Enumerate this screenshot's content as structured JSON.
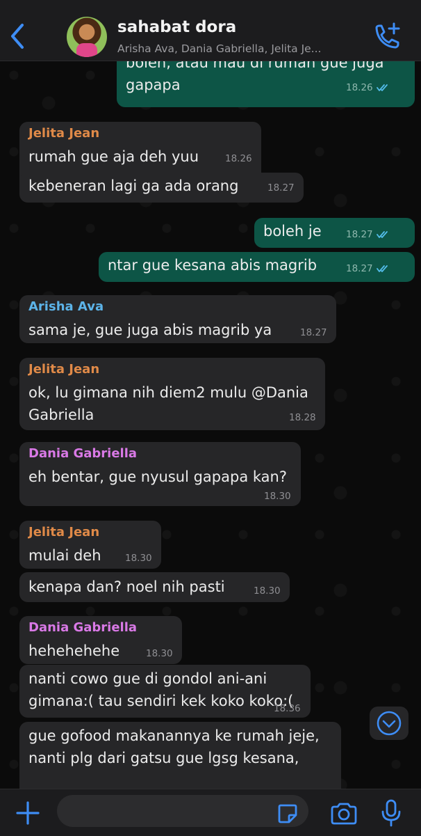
{
  "header": {
    "title": "sahabat dora",
    "subtitle": "Arisha Ava, Dania Gabriella, Jelita Je..."
  },
  "colors": {
    "accent": "#3e8df5",
    "incoming_bubble": "#262628",
    "outgoing_bubble": "#0d5546",
    "name_jelita": "#e08a48",
    "name_arisha": "#5cb3e8",
    "name_dania": "#d979e6"
  },
  "icons": {
    "back": "chevron-left-icon",
    "call": "phone-plus-icon",
    "scroll_down": "chevron-down-circle-icon",
    "attach": "plus-icon",
    "sticker": "sticker-icon",
    "camera": "camera-icon",
    "mic": "microphone-icon"
  },
  "messages": [
    {
      "dir": "out",
      "text": "boleh, atau mau di rumah gue juga\ngapapa",
      "time": "18.26",
      "read": true
    },
    {
      "dir": "in",
      "sender": "Jelita Jean",
      "text": "rumah gue aja deh yuu",
      "time": "18.26"
    },
    {
      "dir": "in",
      "text": "kebeneran lagi ga ada orang",
      "time": "18.27"
    },
    {
      "dir": "out",
      "text": "boleh je",
      "time": "18.27",
      "read": true
    },
    {
      "dir": "out",
      "text": "ntar gue kesana abis magrib",
      "time": "18.27",
      "read": true
    },
    {
      "dir": "in",
      "sender": "Arisha Ava",
      "text": "sama je, gue juga abis magrib ya",
      "time": "18.27"
    },
    {
      "dir": "in",
      "sender": "Jelita Jean",
      "text": "ok, lu gimana nih diem2 mulu @Dania\nGabriella",
      "time": "18.28"
    },
    {
      "dir": "in",
      "sender": "Dania Gabriella",
      "text": "eh bentar, gue nyusul gapapa kan?",
      "time": "18.30"
    },
    {
      "dir": "in",
      "sender": "Jelita Jean",
      "text": "mulai deh",
      "time": "18.30"
    },
    {
      "dir": "in",
      "text": "kenapa dan? noel nih pasti",
      "time": "18.30"
    },
    {
      "dir": "in",
      "sender": "Dania Gabriella",
      "text": "hehehehehe",
      "time": "18.30"
    },
    {
      "dir": "in",
      "text": "nanti cowo gue di gondol ani-ani\ngimana:( tau sendiri kek koko koko:(",
      "time": "18.36"
    },
    {
      "dir": "in",
      "text": "gue gofood makanannya ke rumah jeje,\nnanti plg dari gatsu gue lgsg kesana,",
      "time": ""
    }
  ]
}
